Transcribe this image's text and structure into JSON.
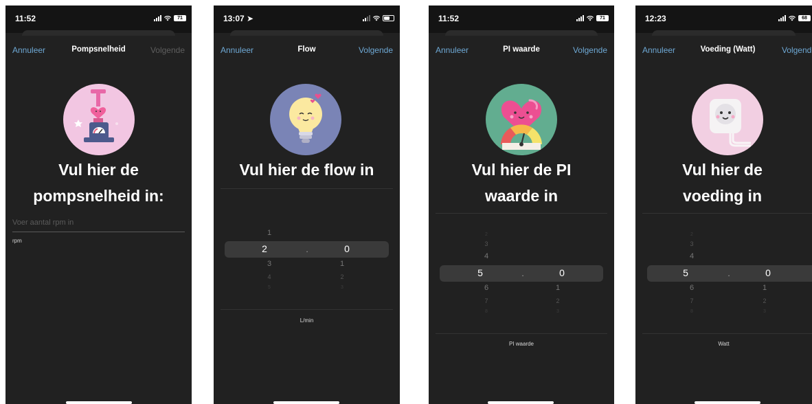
{
  "screens": [
    {
      "status": {
        "time": "11:52",
        "battery": "71"
      },
      "nav": {
        "cancel": "Annuleer",
        "title": "Pompsnelheid",
        "next": "Volgende"
      },
      "heading": {
        "line1": "Vul hier de",
        "line2": "pompsnelheid in:"
      },
      "input": {
        "placeholder": "Voer aantal rpm in"
      },
      "unit": "rpm"
    },
    {
      "status": {
        "time": "13:07"
      },
      "nav": {
        "cancel": "Annuleer",
        "title": "Flow",
        "next": "Volgende"
      },
      "heading": {
        "line1": "Vul hier de flow in"
      },
      "picker": {
        "integer": {
          "above": [
            "1"
          ],
          "selected": "2",
          "below": [
            "3",
            "4",
            "5"
          ]
        },
        "separator": ".",
        "decimal": {
          "above": [],
          "selected": "0",
          "below": [
            "1",
            "2",
            "3"
          ]
        }
      },
      "unit": "L/min"
    },
    {
      "status": {
        "time": "11:52",
        "battery": "71"
      },
      "nav": {
        "cancel": "Annuleer",
        "title": "PI waarde",
        "next": "Volgende"
      },
      "heading": {
        "line1": "Vul hier de PI",
        "line2": "waarde in"
      },
      "picker": {
        "integer": {
          "above": [
            "2",
            "3",
            "4"
          ],
          "selected": "5",
          "below": [
            "6",
            "7",
            "8"
          ]
        },
        "separator": ".",
        "decimal": {
          "above": [],
          "selected": "0",
          "below": [
            "1",
            "2",
            "3"
          ]
        }
      },
      "unit": "PI waarde"
    },
    {
      "status": {
        "time": "12:23",
        "battery": "68"
      },
      "nav": {
        "cancel": "Annuleer",
        "title": "Voeding (Watt)",
        "next": "Volgende"
      },
      "heading": {
        "line1": "Vul hier de",
        "line2": "voeding in"
      },
      "picker": {
        "integer": {
          "above": [
            "2",
            "3",
            "4"
          ],
          "selected": "5",
          "below": [
            "6",
            "7",
            "8"
          ]
        },
        "separator": ".",
        "decimal": {
          "above": [],
          "selected": "0",
          "below": [
            "1",
            "2",
            "3"
          ]
        }
      },
      "unit": "Watt"
    }
  ],
  "colors": {
    "background": "#212121",
    "link": "#6ea8d4",
    "disabled": "#5e5e5e",
    "picker_highlight": "#3a3a3a"
  },
  "illustrations": [
    "pump-gauge-illustration",
    "lightbulb-illustration",
    "heart-gauge-illustration",
    "power-outlet-illustration"
  ]
}
